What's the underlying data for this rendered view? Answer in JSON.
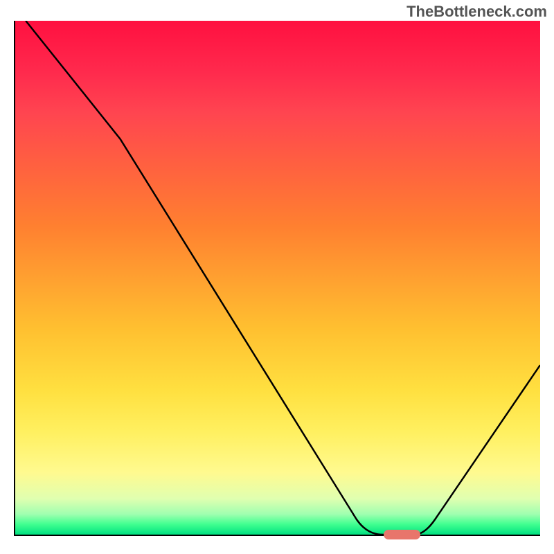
{
  "watermark": "TheBottleneck.com",
  "chart_data": {
    "type": "line",
    "title": "",
    "xlabel": "",
    "ylabel": "",
    "xlim": [
      0,
      100
    ],
    "ylim": [
      0,
      100
    ],
    "curve_points": [
      {
        "x": 2,
        "y": 100
      },
      {
        "x": 20,
        "y": 77
      },
      {
        "x": 65,
        "y": 3
      },
      {
        "x": 70,
        "y": 0
      },
      {
        "x": 76,
        "y": 0
      },
      {
        "x": 80,
        "y": 3
      },
      {
        "x": 100,
        "y": 33
      }
    ],
    "optimal_marker": {
      "x_start": 70,
      "x_end": 77,
      "y": 0
    },
    "gradient_colors": {
      "top": "#ff1040",
      "middle": "#ffc030",
      "bottom": "#00e080"
    }
  }
}
